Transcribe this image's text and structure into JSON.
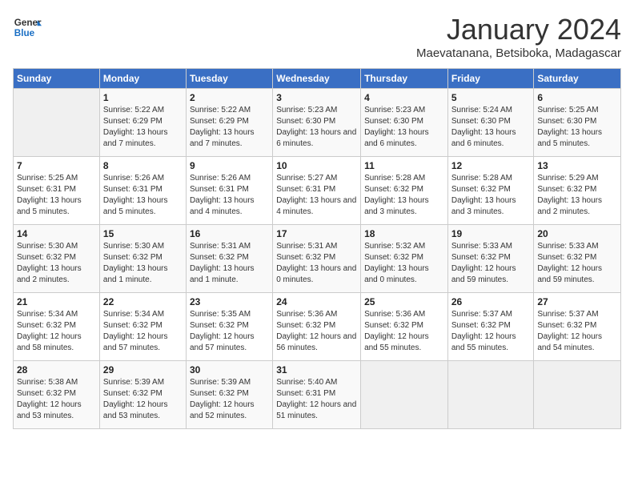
{
  "header": {
    "logo_line1": "General",
    "logo_line2": "Blue",
    "month": "January 2024",
    "location": "Maevatanana, Betsiboka, Madagascar"
  },
  "weekdays": [
    "Sunday",
    "Monday",
    "Tuesday",
    "Wednesday",
    "Thursday",
    "Friday",
    "Saturday"
  ],
  "weeks": [
    [
      {
        "day": "",
        "sunrise": "",
        "sunset": "",
        "daylight": ""
      },
      {
        "day": "1",
        "sunrise": "Sunrise: 5:22 AM",
        "sunset": "Sunset: 6:29 PM",
        "daylight": "Daylight: 13 hours and 7 minutes."
      },
      {
        "day": "2",
        "sunrise": "Sunrise: 5:22 AM",
        "sunset": "Sunset: 6:29 PM",
        "daylight": "Daylight: 13 hours and 7 minutes."
      },
      {
        "day": "3",
        "sunrise": "Sunrise: 5:23 AM",
        "sunset": "Sunset: 6:30 PM",
        "daylight": "Daylight: 13 hours and 6 minutes."
      },
      {
        "day": "4",
        "sunrise": "Sunrise: 5:23 AM",
        "sunset": "Sunset: 6:30 PM",
        "daylight": "Daylight: 13 hours and 6 minutes."
      },
      {
        "day": "5",
        "sunrise": "Sunrise: 5:24 AM",
        "sunset": "Sunset: 6:30 PM",
        "daylight": "Daylight: 13 hours and 6 minutes."
      },
      {
        "day": "6",
        "sunrise": "Sunrise: 5:25 AM",
        "sunset": "Sunset: 6:30 PM",
        "daylight": "Daylight: 13 hours and 5 minutes."
      }
    ],
    [
      {
        "day": "7",
        "sunrise": "Sunrise: 5:25 AM",
        "sunset": "Sunset: 6:31 PM",
        "daylight": "Daylight: 13 hours and 5 minutes."
      },
      {
        "day": "8",
        "sunrise": "Sunrise: 5:26 AM",
        "sunset": "Sunset: 6:31 PM",
        "daylight": "Daylight: 13 hours and 5 minutes."
      },
      {
        "day": "9",
        "sunrise": "Sunrise: 5:26 AM",
        "sunset": "Sunset: 6:31 PM",
        "daylight": "Daylight: 13 hours and 4 minutes."
      },
      {
        "day": "10",
        "sunrise": "Sunrise: 5:27 AM",
        "sunset": "Sunset: 6:31 PM",
        "daylight": "Daylight: 13 hours and 4 minutes."
      },
      {
        "day": "11",
        "sunrise": "Sunrise: 5:28 AM",
        "sunset": "Sunset: 6:32 PM",
        "daylight": "Daylight: 13 hours and 3 minutes."
      },
      {
        "day": "12",
        "sunrise": "Sunrise: 5:28 AM",
        "sunset": "Sunset: 6:32 PM",
        "daylight": "Daylight: 13 hours and 3 minutes."
      },
      {
        "day": "13",
        "sunrise": "Sunrise: 5:29 AM",
        "sunset": "Sunset: 6:32 PM",
        "daylight": "Daylight: 13 hours and 2 minutes."
      }
    ],
    [
      {
        "day": "14",
        "sunrise": "Sunrise: 5:30 AM",
        "sunset": "Sunset: 6:32 PM",
        "daylight": "Daylight: 13 hours and 2 minutes."
      },
      {
        "day": "15",
        "sunrise": "Sunrise: 5:30 AM",
        "sunset": "Sunset: 6:32 PM",
        "daylight": "Daylight: 13 hours and 1 minute."
      },
      {
        "day": "16",
        "sunrise": "Sunrise: 5:31 AM",
        "sunset": "Sunset: 6:32 PM",
        "daylight": "Daylight: 13 hours and 1 minute."
      },
      {
        "day": "17",
        "sunrise": "Sunrise: 5:31 AM",
        "sunset": "Sunset: 6:32 PM",
        "daylight": "Daylight: 13 hours and 0 minutes."
      },
      {
        "day": "18",
        "sunrise": "Sunrise: 5:32 AM",
        "sunset": "Sunset: 6:32 PM",
        "daylight": "Daylight: 13 hours and 0 minutes."
      },
      {
        "day": "19",
        "sunrise": "Sunrise: 5:33 AM",
        "sunset": "Sunset: 6:32 PM",
        "daylight": "Daylight: 12 hours and 59 minutes."
      },
      {
        "day": "20",
        "sunrise": "Sunrise: 5:33 AM",
        "sunset": "Sunset: 6:32 PM",
        "daylight": "Daylight: 12 hours and 59 minutes."
      }
    ],
    [
      {
        "day": "21",
        "sunrise": "Sunrise: 5:34 AM",
        "sunset": "Sunset: 6:32 PM",
        "daylight": "Daylight: 12 hours and 58 minutes."
      },
      {
        "day": "22",
        "sunrise": "Sunrise: 5:34 AM",
        "sunset": "Sunset: 6:32 PM",
        "daylight": "Daylight: 12 hours and 57 minutes."
      },
      {
        "day": "23",
        "sunrise": "Sunrise: 5:35 AM",
        "sunset": "Sunset: 6:32 PM",
        "daylight": "Daylight: 12 hours and 57 minutes."
      },
      {
        "day": "24",
        "sunrise": "Sunrise: 5:36 AM",
        "sunset": "Sunset: 6:32 PM",
        "daylight": "Daylight: 12 hours and 56 minutes."
      },
      {
        "day": "25",
        "sunrise": "Sunrise: 5:36 AM",
        "sunset": "Sunset: 6:32 PM",
        "daylight": "Daylight: 12 hours and 55 minutes."
      },
      {
        "day": "26",
        "sunrise": "Sunrise: 5:37 AM",
        "sunset": "Sunset: 6:32 PM",
        "daylight": "Daylight: 12 hours and 55 minutes."
      },
      {
        "day": "27",
        "sunrise": "Sunrise: 5:37 AM",
        "sunset": "Sunset: 6:32 PM",
        "daylight": "Daylight: 12 hours and 54 minutes."
      }
    ],
    [
      {
        "day": "28",
        "sunrise": "Sunrise: 5:38 AM",
        "sunset": "Sunset: 6:32 PM",
        "daylight": "Daylight: 12 hours and 53 minutes."
      },
      {
        "day": "29",
        "sunrise": "Sunrise: 5:39 AM",
        "sunset": "Sunset: 6:32 PM",
        "daylight": "Daylight: 12 hours and 53 minutes."
      },
      {
        "day": "30",
        "sunrise": "Sunrise: 5:39 AM",
        "sunset": "Sunset: 6:32 PM",
        "daylight": "Daylight: 12 hours and 52 minutes."
      },
      {
        "day": "31",
        "sunrise": "Sunrise: 5:40 AM",
        "sunset": "Sunset: 6:31 PM",
        "daylight": "Daylight: 12 hours and 51 minutes."
      },
      {
        "day": "",
        "sunrise": "",
        "sunset": "",
        "daylight": ""
      },
      {
        "day": "",
        "sunrise": "",
        "sunset": "",
        "daylight": ""
      },
      {
        "day": "",
        "sunrise": "",
        "sunset": "",
        "daylight": ""
      }
    ]
  ]
}
